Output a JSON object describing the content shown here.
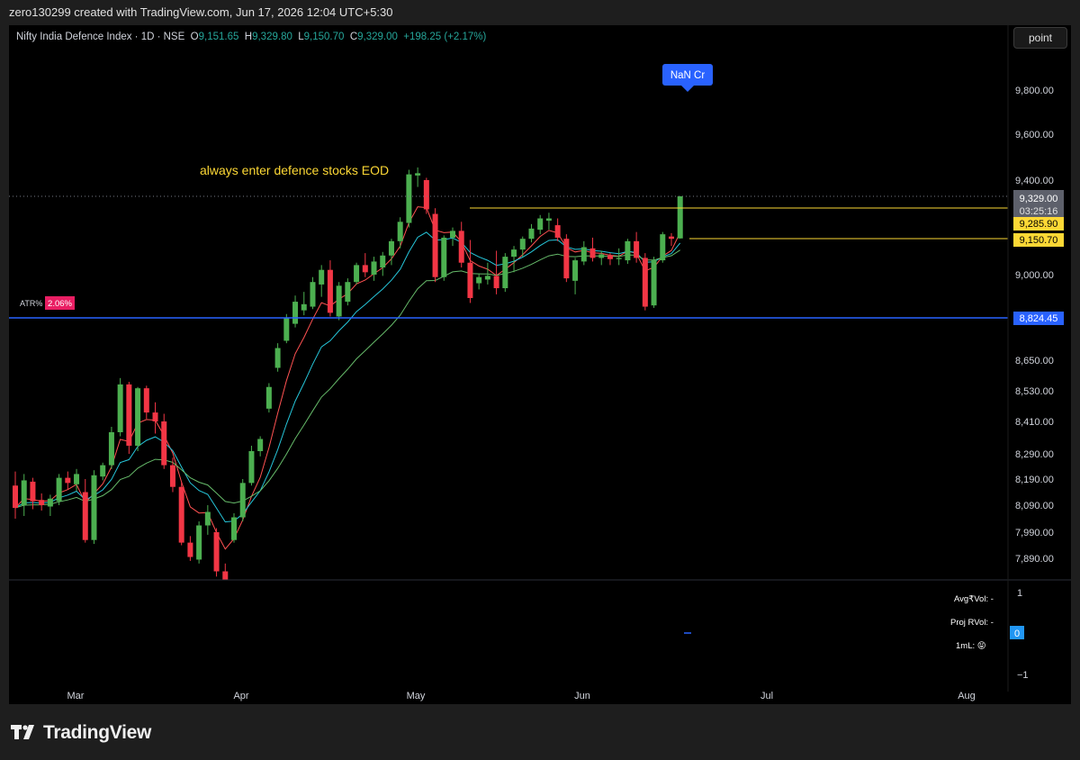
{
  "header": {
    "created_text": "zero130299 created with TradingView.com, Jun 17, 2026 12:04 UTC+5:30"
  },
  "legend": {
    "symbol": "Nifty India Defence Index · 1D · NSE",
    "o_label": "O",
    "o_value": "9,151.65",
    "h_label": "H",
    "h_value": "9,329.80",
    "l_label": "L",
    "l_value": "9,150.70",
    "c_label": "C",
    "c_value": "9,329.00",
    "change": "+198.25 (+2.17%)"
  },
  "toolbar": {
    "mode_label": "point"
  },
  "annotations": {
    "note": "always enter defence stocks EOD",
    "nan_badge": "NaN Cr",
    "atr_label": "ATR%",
    "atr_value": "2.06%"
  },
  "price_labels": {
    "last": "9,329.00",
    "countdown": "03:25:16",
    "upper_line": "9,285.90",
    "lower_line": "9,150.70",
    "support_line": "8,824.45"
  },
  "indicator": {
    "avgvol": "Avg₹Vol: -",
    "projrvol": "Proj RVol: -",
    "iml": "1mL: 😝",
    "value_label": "0",
    "axis_top": "1",
    "axis_bottom": "−1"
  },
  "brand": {
    "name": "TradingView"
  },
  "colors": {
    "up": "#4caf50",
    "down": "#f23645",
    "support": "#2962ff",
    "line_yellow": "#fdd835",
    "ma_red": "#ff5252",
    "ma_cyan": "#26c6da",
    "ma_green": "#66bb6a"
  },
  "chart_data": {
    "type": "candlestick",
    "title": "Nifty India Defence Index · 1D · NSE",
    "x_tick_labels": [
      "Mar",
      "Apr",
      "May",
      "Jun",
      "Jul",
      "Aug"
    ],
    "y_tick_labels": [
      "9,800.00",
      "9,600.00",
      "9,400.00",
      "9,000.00",
      "8,650.00",
      "8,530.00",
      "8,410.00",
      "8,290.00",
      "8,190.00",
      "8,090.00",
      "7,990.00",
      "7,890.00"
    ],
    "y_ticks": [
      9800,
      9600,
      9400,
      9000,
      8650,
      8530,
      8410,
      8290,
      8190,
      8090,
      7990,
      7890
    ],
    "horizontal_lines": [
      {
        "label": "8,824.45",
        "value": 8824.45,
        "color": "#2962ff"
      },
      {
        "label": "9,285.90",
        "value": 9285.9,
        "color": "#fdd835"
      },
      {
        "label": "9,150.70",
        "value": 9150.7,
        "color": "#fdd835"
      }
    ],
    "candles": [
      [
        8165,
        8220,
        8040,
        8080
      ],
      [
        8090,
        8210,
        8050,
        8185
      ],
      [
        8180,
        8195,
        8075,
        8105
      ],
      [
        8110,
        8135,
        8070,
        8090
      ],
      [
        8085,
        8130,
        8050,
        8115
      ],
      [
        8105,
        8210,
        8090,
        8195
      ],
      [
        8195,
        8220,
        8150,
        8175
      ],
      [
        8170,
        8230,
        8145,
        8210
      ],
      [
        8140,
        8190,
        7950,
        7960
      ],
      [
        7960,
        8225,
        7945,
        8205
      ],
      [
        8200,
        8255,
        8185,
        8245
      ],
      [
        8245,
        8390,
        8230,
        8370
      ],
      [
        8370,
        8580,
        8355,
        8555
      ],
      [
        8555,
        8565,
        8290,
        8320
      ],
      [
        8320,
        8545,
        8300,
        8540
      ],
      [
        8540,
        8550,
        8420,
        8445
      ],
      [
        8445,
        8485,
        8365,
        8410
      ],
      [
        8410,
        8440,
        8230,
        8245
      ],
      [
        8245,
        8275,
        8140,
        8160
      ],
      [
        8160,
        8180,
        7940,
        7950
      ],
      [
        7950,
        7975,
        7880,
        7895
      ],
      [
        7885,
        8030,
        7870,
        8015
      ],
      [
        8015,
        8090,
        7980,
        8065
      ],
      [
        7990,
        8005,
        7820,
        7840
      ],
      [
        7840,
        7870,
        7780,
        7800
      ],
      [
        7960,
        8060,
        7950,
        8045
      ],
      [
        8045,
        8190,
        8030,
        8175
      ],
      [
        8175,
        8320,
        8165,
        8300
      ],
      [
        8300,
        8355,
        8280,
        8345
      ],
      [
        8460,
        8560,
        8445,
        8545
      ],
      [
        8620,
        8720,
        8605,
        8700
      ],
      [
        8730,
        8840,
        8720,
        8825
      ],
      [
        8800,
        8915,
        8785,
        8890
      ],
      [
        8855,
        8930,
        8835,
        8880
      ],
      [
        8870,
        8990,
        8860,
        8970
      ],
      [
        8960,
        9040,
        8910,
        9020
      ],
      [
        9020,
        9060,
        8830,
        8845
      ],
      [
        8830,
        8970,
        8815,
        8955
      ],
      [
        8890,
        8985,
        8875,
        8970
      ],
      [
        8970,
        9050,
        8960,
        9040
      ],
      [
        9040,
        9090,
        8990,
        9010
      ],
      [
        9000,
        9075,
        8975,
        9055
      ],
      [
        9030,
        9095,
        8995,
        9080
      ],
      [
        9080,
        9150,
        9040,
        9140
      ],
      [
        9140,
        9245,
        9110,
        9225
      ],
      [
        9220,
        9445,
        9200,
        9425
      ],
      [
        9420,
        9455,
        9370,
        9430
      ],
      [
        9400,
        9410,
        9260,
        9280
      ],
      [
        9260,
        9285,
        8970,
        8990
      ],
      [
        8990,
        9165,
        8975,
        9155
      ],
      [
        9155,
        9200,
        9120,
        9185
      ],
      [
        9185,
        9225,
        9030,
        9050
      ],
      [
        9050,
        9145,
        8885,
        8905
      ],
      [
        8965,
        9005,
        8940,
        8990
      ],
      [
        8980,
        9050,
        8960,
        8995
      ],
      [
        8995,
        9100,
        8920,
        8945
      ],
      [
        8945,
        9090,
        8930,
        9075
      ],
      [
        9075,
        9120,
        9010,
        9105
      ],
      [
        9105,
        9160,
        9075,
        9150
      ],
      [
        9150,
        9215,
        9135,
        9195
      ],
      [
        9190,
        9255,
        9170,
        9240
      ],
      [
        9230,
        9265,
        9190,
        9240
      ],
      [
        9210,
        9240,
        9140,
        9155
      ],
      [
        9150,
        9170,
        8970,
        8985
      ],
      [
        8975,
        9070,
        8920,
        9060
      ],
      [
        9055,
        9140,
        9040,
        9115
      ],
      [
        9110,
        9155,
        9055,
        9070
      ],
      [
        9070,
        9100,
        9040,
        9085
      ],
      [
        9080,
        9090,
        9040,
        9065
      ],
      [
        9065,
        9110,
        9040,
        9070
      ],
      [
        9060,
        9150,
        9045,
        9140
      ],
      [
        9140,
        9180,
        9050,
        9070
      ],
      [
        9070,
        9090,
        8855,
        8870
      ],
      [
        8875,
        9075,
        8865,
        9060
      ],
      [
        9060,
        9180,
        9050,
        9170
      ],
      [
        9160,
        9175,
        9120,
        9150
      ],
      [
        9151.65,
        9329.8,
        9150.7,
        9329
      ]
    ],
    "series": []
  }
}
